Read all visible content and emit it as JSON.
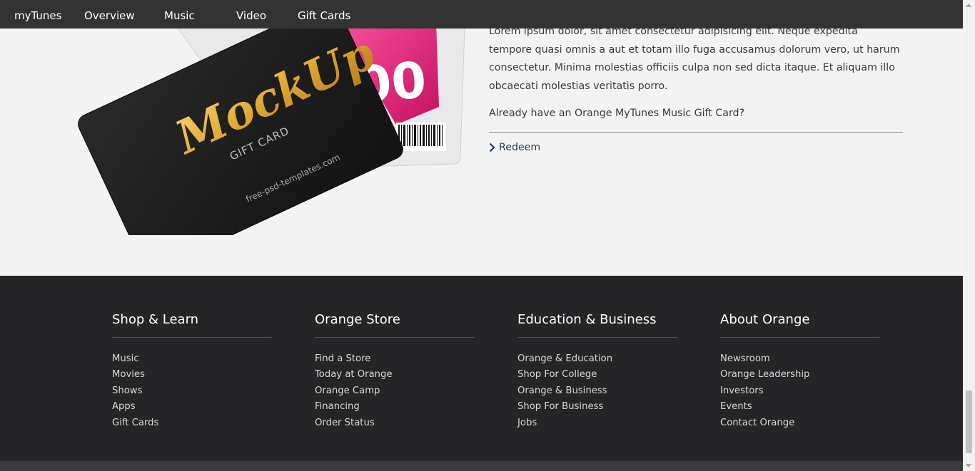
{
  "nav": {
    "brand": "myTunes",
    "items": [
      "Overview",
      "Music",
      "Video",
      "Gift Cards"
    ]
  },
  "hero": {
    "image": {
      "brand_text": "MockUp",
      "sub_text": "GIFT CARD",
      "url_text": "free-psd-templates.com",
      "amount_text": "00"
    },
    "paragraph": "Lorem ipsum dolor, sit amet consectetur adipisicing elit. Neque expedita tempore quasi omnis a aut et totam illo fuga accusamus dolorum vero, ut harum consectetur. Minima molestias officiis culpa non sed dicta itaque. Et aliquam illo obcaecati molestias veritatis porro.",
    "question": "Already have an Orange MyTunes Music Gift Card?",
    "redeem_label": "Redeem"
  },
  "footer": {
    "columns": [
      {
        "title": "Shop & Learn",
        "links": [
          "Music",
          "Movies",
          "Shows",
          "Apps",
          "Gift Cards"
        ]
      },
      {
        "title": "Orange Store",
        "links": [
          "Find a Store",
          "Today at Orange",
          "Orange Camp",
          "Financing",
          "Order Status"
        ]
      },
      {
        "title": "Education & Business",
        "links": [
          "Orange & Education",
          "Shop For College",
          "Orange & Business",
          "Shop For Business",
          "Jobs"
        ]
      },
      {
        "title": "About Orange",
        "links": [
          "Newsroom",
          "Orange Leadership",
          "Investors",
          "Events",
          "Contact Orange"
        ]
      }
    ]
  },
  "colors": {
    "nav_bg": "#333333",
    "footer_bg": "#252528",
    "link_accent": "#27405e",
    "card_pink": "#d81b73",
    "card_gold": "#e8b53a"
  }
}
